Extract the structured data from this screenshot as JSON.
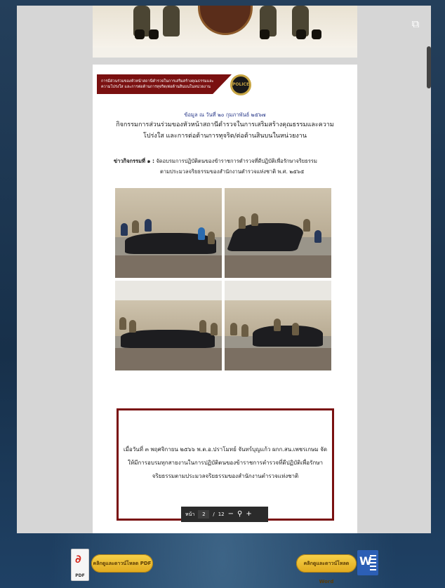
{
  "viewer": {
    "popout_icon": "external-link-icon",
    "page1": {
      "description_icon": "police-emblem"
    },
    "page2": {
      "banner_text": "การมีส่วนร่วมของหัวหน้าสถานีตำรวจในการเสริมสร้างคุณธรรมและความโปร่งใส และการต่อต้านการทุจริต/ต่อต้านสินบนในหน่วยงาน",
      "badge_text": "POLICE",
      "date_line": "ข้อมูล ณ วันที่ ๒๐ กุมภาพันธ์ ๒๕๖๗",
      "headline": "กิจกรรมการส่วนร่วมของหัวหน้าสถานีตำรวจในการเสริมสร้างคุณธรรมและความโปร่งใส และการต่อต้านการทุจริต/ต่อต้านสินบนในหน่วยงาน",
      "activity_prefix": "ข่าวกิจกรรมที่ ๑ :",
      "activity_line1": "จัดอบรมการปฏิบัติตนของข้าราชการตำรวจที่ดีปฏิบัติเพื่อรักษาจริยธรรม",
      "activity_line2": "ตามประมวลจริยธรรมของสำนักงานตำรวจแห่งชาติ พ.ศ. ๒๕๖๕",
      "body_text": "เมื่อวันที่ ๓ พฤศจิกายน ๒๕๖๖ พ.ต.อ.ปราโมทย์ จันทร์บุญแก้ว ผกก.สน.เพชรเกษม จัดให้มีการอบรมทุกสายงานในการปฏิบัติตนของข้าราชการตำรวจที่ดีปฏิบัติเพื่อรักษาจริยธรรมตามประมวลจริยธรรมของสำนักงานตำรวจแห่งชาติ"
    }
  },
  "pager": {
    "page_label": "หน้า",
    "current_page": "2",
    "separator": "/",
    "total_pages": "12",
    "zoom_out_icon": "minus-icon",
    "zoom_icon": "magnifier-icon",
    "zoom_in_icon": "plus-icon"
  },
  "downloads": {
    "pdf_icon_label": "PDF",
    "pdf_button": "คลิกดูและดาวน์โหลด PDF",
    "word_button": "คลิกดูและดาวน์โหลด Word",
    "word_icon_letter": "W"
  },
  "colors": {
    "banner_red": "#7a1010",
    "box_border": "#7a1010",
    "button_gold": "#f0c030",
    "word_blue": "#2c5fb5",
    "pdf_red": "#d62b1f"
  }
}
